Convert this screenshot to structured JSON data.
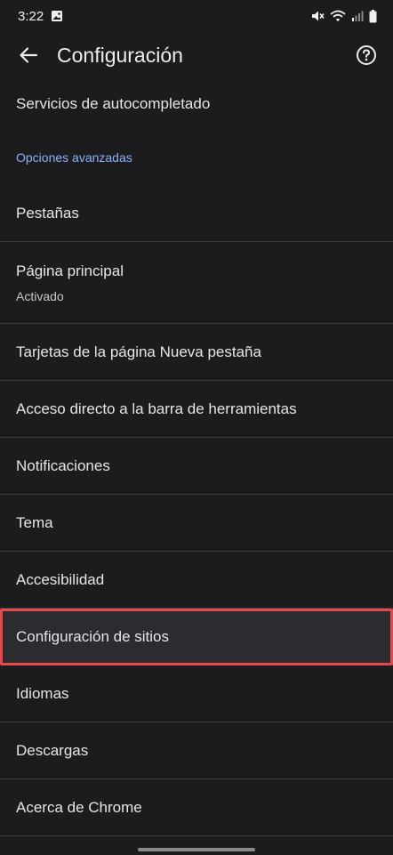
{
  "status_bar": {
    "time": "3:22"
  },
  "app_bar": {
    "title": "Configuración"
  },
  "list": {
    "autocomplete": "Servicios de autocompletado",
    "section_advanced": "Opciones avanzadas",
    "items": [
      {
        "label": "Pestañas"
      },
      {
        "label": "Página principal",
        "sub": "Activado"
      },
      {
        "label": "Tarjetas de la página Nueva pestaña"
      },
      {
        "label": "Acceso directo a la barra de herramientas"
      },
      {
        "label": "Notificaciones"
      },
      {
        "label": "Tema"
      },
      {
        "label": "Accesibilidad"
      },
      {
        "label": "Configuración de sitios"
      },
      {
        "label": "Idiomas"
      },
      {
        "label": "Descargas"
      },
      {
        "label": "Acerca de Chrome"
      }
    ]
  },
  "colors": {
    "background": "#1c1c1f",
    "section_accent": "#8ab4f8",
    "highlight_outline": "#e5484d"
  }
}
